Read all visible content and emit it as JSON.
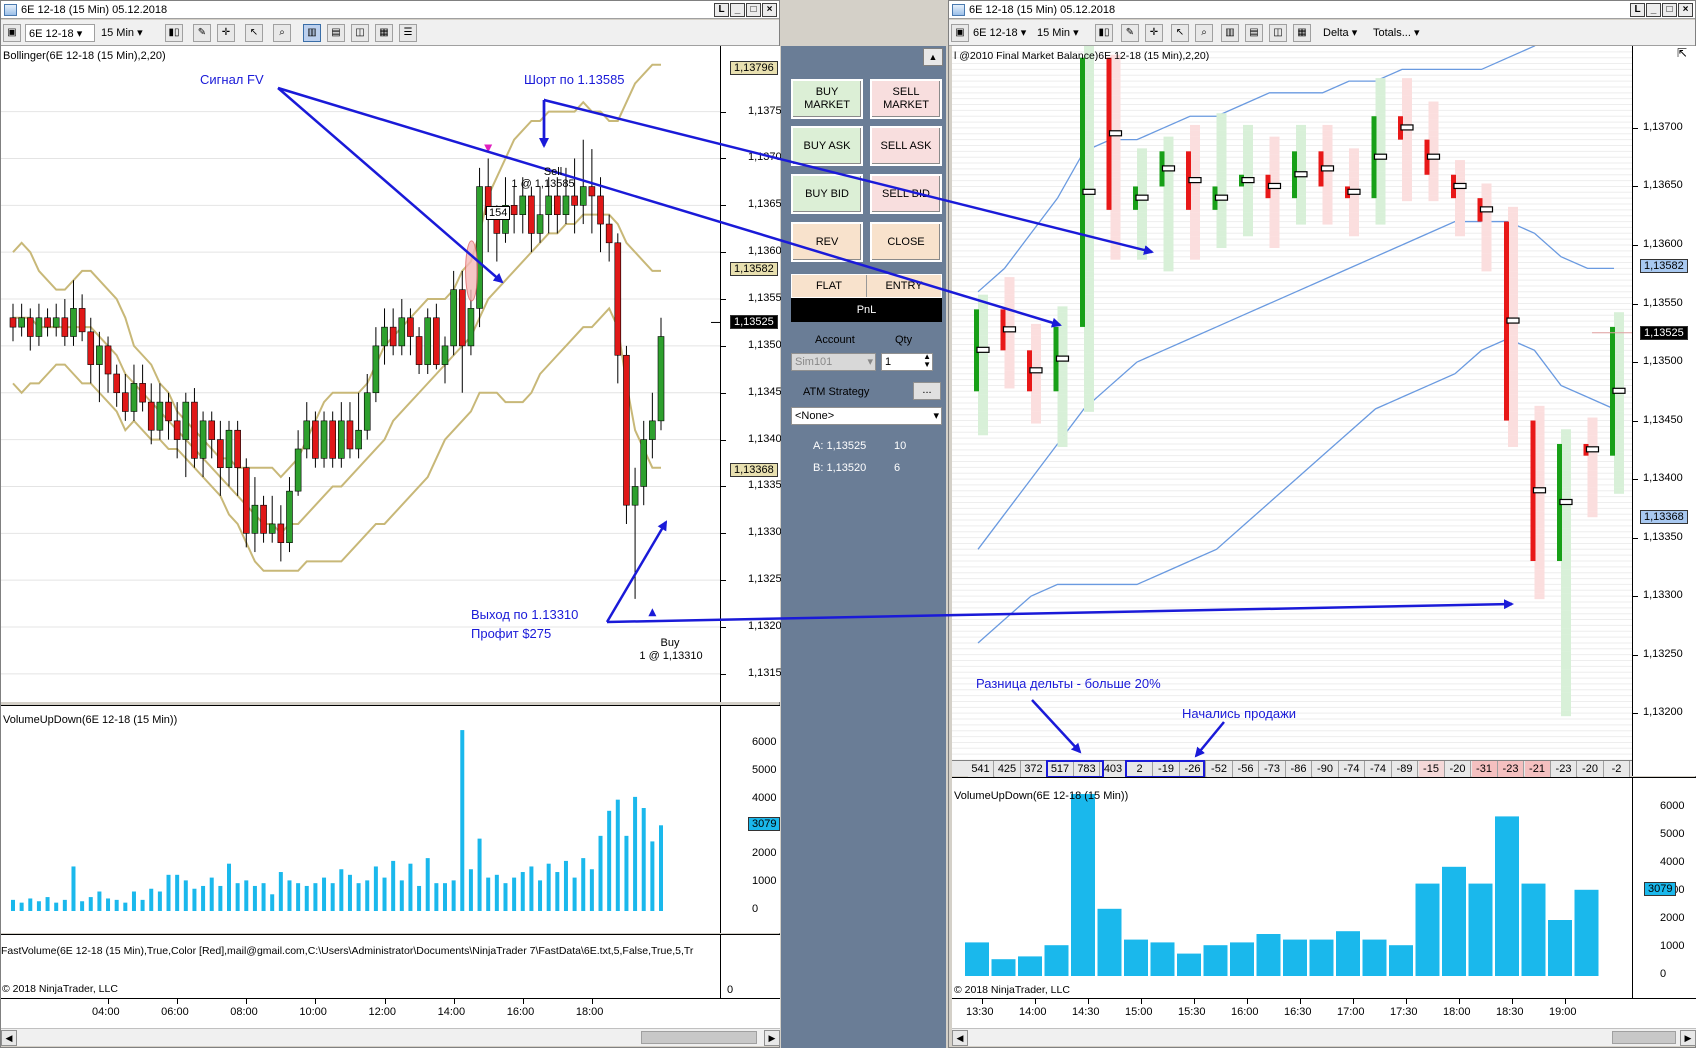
{
  "left_window": {
    "title": "6E 12-18 (15 Min)  05.12.2018",
    "toolbar": {
      "instrument": "6E 12-18",
      "interval": "15 Min"
    },
    "indicator_title": "Bollinger(6E 12-18 (15 Min),2,20)",
    "y_labels": [
      "1,13750",
      "1,13700",
      "1,13650",
      "1,13600",
      "1,13550",
      "1,13500",
      "1,13450",
      "1,13400",
      "1,13350",
      "1,13300",
      "1,13250",
      "1,13200",
      "1,13150"
    ],
    "price_tags": {
      "upper": "1,13796",
      "mid": "1,13582",
      "last": "1,13525",
      "lower": "1,13368"
    },
    "sell_label": "Sell",
    "sell_fill": "1 @ 1,13585",
    "buy_label": "Buy",
    "buy_fill": "1 @ 1,13310",
    "bar_counter": "154",
    "vol_title": "VolumeUpDown(6E 12-18 (15 Min))",
    "vol_labels": [
      "6000",
      "5000",
      "4000",
      "3000",
      "2000",
      "1000",
      "0"
    ],
    "vol_tag": "3079",
    "fastvol_title": "FastVolume(6E  12-18  (15  Min),True,Color  [Red],mail@gmail.com,C:\\Users\\Administrator\\Documents\\NinjaTrader  7\\FastData\\6E.txt,5,False,True,5,Tr",
    "fastvol_zero": "0",
    "copyright": "© 2018 NinjaTrader, LLC",
    "x_labels": [
      "04:00",
      "06:00",
      "08:00",
      "10:00",
      "12:00",
      "14:00",
      "16:00",
      "18:00"
    ]
  },
  "annotations": {
    "signal": "Сигнал FV",
    "short": "Шорт по 1.13585",
    "exit": "Выход по 1.13310",
    "profit": "Профит $275",
    "delta_diff": "Разница дельты - больше 20%",
    "selling": "Начались продажи"
  },
  "trade_panel": {
    "buy_market": "BUY MARKET",
    "sell_market": "SELL MARKET",
    "buy_ask": "BUY ASK",
    "sell_ask": "SELL ASK",
    "buy_bid": "BUY BID",
    "sell_bid": "SELL BID",
    "rev": "REV",
    "close": "CLOSE",
    "flat": "FLAT",
    "entry": "ENTRY",
    "pnl": "PnL",
    "account_label": "Account",
    "qty_label": "Qty",
    "account_value": "Sim101",
    "qty_value": "1",
    "atm_label": "ATM Strategy",
    "atm_more": "...",
    "atm_value": "<None>",
    "ask_label": "A: 1,13525",
    "ask_size": "10",
    "bid_label": "B: 1,13520",
    "bid_size": "6"
  },
  "right_window": {
    "title": "6E 12-18 (15 Min)  05.12.2018",
    "toolbar": {
      "instrument": "6E 12-18",
      "interval": "15 Min",
      "delta": "Delta",
      "totals": "Totals..."
    },
    "indicator_title": "l @2010 Final Market Balance)6E 12-18 (15 Min),2,20)",
    "y_labels": [
      "1,13700",
      "1,13650",
      "1,13600",
      "1,13550",
      "1,13500",
      "1,13450",
      "1,13400",
      "1,13350",
      "1,13300",
      "1,13250",
      "1,13200"
    ],
    "price_tags": {
      "mid": "1,13582",
      "last": "1,13525",
      "lower": "1,13368"
    },
    "deltas": [
      "541",
      "425",
      "372",
      "517",
      "783",
      "403",
      "2",
      "-19",
      "-26",
      "-52",
      "-56",
      "-73",
      "-86",
      "-90",
      "-74",
      "-74",
      "-89",
      "-15",
      "-20",
      "-31",
      "-23",
      "-21",
      "-23",
      "-20",
      "-2"
    ],
    "vol_title": "VolumeUpDown(6E 12-18 (15 Min))",
    "vol_labels": [
      "6000",
      "5000",
      "4000",
      "3000",
      "2000",
      "1000",
      "0"
    ],
    "vol_tag": "3079",
    "copyright": "© 2018 NinjaTrader, LLC",
    "x_labels": [
      "13:30",
      "14:00",
      "14:30",
      "15:00",
      "15:30",
      "16:00",
      "16:30",
      "17:00",
      "17:30",
      "18:00",
      "18:30",
      "19:00"
    ]
  },
  "colors": {
    "up": "#2ea02e",
    "down": "#e01818",
    "band": "#c8b878",
    "vol": "#1ab8ec",
    "arrow": "#1a1ad8",
    "bb_right": "#6a9ae0"
  },
  "chart_data": [
    {
      "type": "candlestick",
      "title": "Bollinger(6E 12-18 (15 Min),2,20)",
      "ylim": [
        1.1312,
        1.1382
      ],
      "candles": [
        [
          1.1353,
          1.1352,
          1.13545,
          1.13505
        ],
        [
          1.1352,
          1.1353,
          1.13545,
          1.1351
        ],
        [
          1.1353,
          1.1351,
          1.1354,
          1.13495
        ],
        [
          1.1351,
          1.1353,
          1.13545,
          1.135
        ],
        [
          1.1353,
          1.1352,
          1.1354,
          1.1351
        ],
        [
          1.1352,
          1.1353,
          1.13545,
          1.1351
        ],
        [
          1.1353,
          1.1351,
          1.1355,
          1.135
        ],
        [
          1.1351,
          1.1354,
          1.1357,
          1.135
        ],
        [
          1.1354,
          1.13515,
          1.13555,
          1.13505
        ],
        [
          1.13515,
          1.1348,
          1.1353,
          1.1346
        ],
        [
          1.1348,
          1.135,
          1.13515,
          1.1344
        ],
        [
          1.135,
          1.1347,
          1.1351,
          1.1345
        ],
        [
          1.1347,
          1.1345,
          1.1348,
          1.13435
        ],
        [
          1.1345,
          1.1343,
          1.1347,
          1.1342
        ],
        [
          1.1343,
          1.1346,
          1.1348,
          1.1342
        ],
        [
          1.1346,
          1.1344,
          1.1348,
          1.1343
        ],
        [
          1.1344,
          1.1341,
          1.1346,
          1.13395
        ],
        [
          1.1341,
          1.1344,
          1.1346,
          1.134
        ],
        [
          1.1344,
          1.1342,
          1.1345,
          1.134
        ],
        [
          1.1342,
          1.134,
          1.1344,
          1.1338
        ],
        [
          1.134,
          1.1344,
          1.1345,
          1.1336
        ],
        [
          1.1344,
          1.1338,
          1.13455,
          1.1337
        ],
        [
          1.1338,
          1.1342,
          1.1343,
          1.1336
        ],
        [
          1.1342,
          1.134,
          1.1343,
          1.1338
        ],
        [
          1.134,
          1.1337,
          1.1342,
          1.1334
        ],
        [
          1.1337,
          1.1341,
          1.1342,
          1.1335
        ],
        [
          1.1341,
          1.1337,
          1.1342,
          1.1334
        ],
        [
          1.1337,
          1.133,
          1.1338,
          1.13285
        ],
        [
          1.133,
          1.1333,
          1.1336,
          1.1328
        ],
        [
          1.1333,
          1.133,
          1.1334,
          1.1329
        ],
        [
          1.133,
          1.1331,
          1.1334,
          1.1329
        ],
        [
          1.1331,
          1.1329,
          1.1333,
          1.1327
        ],
        [
          1.1329,
          1.13345,
          1.1336,
          1.1328
        ],
        [
          1.13345,
          1.1339,
          1.1341,
          1.1334
        ],
        [
          1.1339,
          1.1342,
          1.1344,
          1.1338
        ],
        [
          1.1342,
          1.1338,
          1.1343,
          1.1337
        ],
        [
          1.1338,
          1.1342,
          1.1343,
          1.1337
        ],
        [
          1.1342,
          1.1338,
          1.1343,
          1.1337
        ],
        [
          1.1338,
          1.1342,
          1.1344,
          1.1337
        ],
        [
          1.1342,
          1.1339,
          1.1344,
          1.1338
        ],
        [
          1.1339,
          1.1341,
          1.1345,
          1.1338
        ],
        [
          1.1341,
          1.1345,
          1.1347,
          1.134
        ],
        [
          1.1345,
          1.135,
          1.1352,
          1.1344
        ],
        [
          1.135,
          1.1352,
          1.1354,
          1.1348
        ],
        [
          1.1352,
          1.135,
          1.1354,
          1.1349
        ],
        [
          1.135,
          1.1353,
          1.1355,
          1.1349
        ],
        [
          1.1353,
          1.1351,
          1.1354,
          1.1349
        ],
        [
          1.1351,
          1.1348,
          1.1352,
          1.1347
        ],
        [
          1.1348,
          1.1353,
          1.1354,
          1.1347
        ],
        [
          1.1353,
          1.1348,
          1.13545,
          1.13475
        ],
        [
          1.1348,
          1.135,
          1.1351,
          1.1346
        ],
        [
          1.135,
          1.1356,
          1.1358,
          1.1349
        ],
        [
          1.1356,
          1.135,
          1.1358,
          1.1345
        ],
        [
          1.135,
          1.1354,
          1.1356,
          1.1349
        ],
        [
          1.1354,
          1.1367,
          1.1369,
          1.1352
        ],
        [
          1.1367,
          1.1364,
          1.137,
          1.136
        ],
        [
          1.1364,
          1.1362,
          1.1365,
          1.1359
        ],
        [
          1.1362,
          1.1365,
          1.1368,
          1.1361
        ],
        [
          1.1365,
          1.1364,
          1.1367,
          1.1362
        ],
        [
          1.1364,
          1.1366,
          1.1368,
          1.1362
        ],
        [
          1.1366,
          1.1362,
          1.1367,
          1.136
        ],
        [
          1.1362,
          1.1364,
          1.1367,
          1.1361
        ],
        [
          1.1364,
          1.1366,
          1.1368,
          1.1362
        ],
        [
          1.1366,
          1.1364,
          1.1368,
          1.1362
        ],
        [
          1.1364,
          1.1366,
          1.1369,
          1.1363
        ],
        [
          1.1366,
          1.1365,
          1.137,
          1.1362
        ],
        [
          1.1365,
          1.1367,
          1.1372,
          1.1363
        ],
        [
          1.1367,
          1.1366,
          1.1371,
          1.1362
        ],
        [
          1.1366,
          1.1363,
          1.1368,
          1.136
        ],
        [
          1.1363,
          1.1361,
          1.1364,
          1.1359
        ],
        [
          1.1361,
          1.1349,
          1.1362,
          1.1346
        ],
        [
          1.1349,
          1.1333,
          1.135,
          1.1331
        ],
        [
          1.1333,
          1.1335,
          1.1337,
          1.1323
        ],
        [
          1.1335,
          1.134,
          1.1342,
          1.1333
        ],
        [
          1.134,
          1.1342,
          1.1345,
          1.1338
        ],
        [
          1.1342,
          1.1351,
          1.1353,
          1.1341
        ]
      ],
      "bb_upper": [
        1.136,
        1.1361,
        1.136,
        1.1358,
        1.1357,
        1.1356,
        1.1356,
        1.1357,
        1.1358,
        1.1358,
        1.1357,
        1.1356,
        1.1355,
        1.1353,
        1.135,
        1.1349,
        1.1348,
        1.1346,
        1.1345,
        1.1343,
        1.1342,
        1.1341,
        1.134,
        1.1339,
        1.1338,
        1.1338,
        1.1337,
        1.1337,
        1.1337,
        1.1337,
        1.1337,
        1.1336,
        1.1337,
        1.1338,
        1.134,
        1.1342,
        1.1344,
        1.1345,
        1.1345,
        1.1345,
        1.1345,
        1.1346,
        1.1348,
        1.135,
        1.1351,
        1.1352,
        1.1353,
        1.1354,
        1.1355,
        1.1355,
        1.1355,
        1.1356,
        1.1358,
        1.1359,
        1.1362,
        1.1366,
        1.1368,
        1.137,
        1.1372,
        1.1373,
        1.1374,
        1.1374,
        1.1375,
        1.1375,
        1.1375,
        1.1375,
        1.1376,
        1.1375,
        1.1375,
        1.1374,
        1.1374,
        1.1376,
        1.1378,
        1.1379,
        1.138,
        1.138
      ],
      "bb_mid": [
        1.1353,
        1.1353,
        1.1353,
        1.1352,
        1.1352,
        1.1352,
        1.1352,
        1.1352,
        1.1352,
        1.1352,
        1.1351,
        1.135,
        1.1349,
        1.1347,
        1.1346,
        1.1345,
        1.1344,
        1.1343,
        1.1342,
        1.1341,
        1.134,
        1.1339,
        1.1338,
        1.1337,
        1.1336,
        1.1335,
        1.1334,
        1.1333,
        1.1332,
        1.1331,
        1.1331,
        1.133,
        1.1331,
        1.1331,
        1.1332,
        1.1333,
        1.1334,
        1.1335,
        1.1335,
        1.1336,
        1.1337,
        1.1338,
        1.1339,
        1.134,
        1.1342,
        1.1343,
        1.1344,
        1.1345,
        1.1346,
        1.1347,
        1.1348,
        1.1349,
        1.135,
        1.1351,
        1.1353,
        1.1355,
        1.1356,
        1.1357,
        1.1358,
        1.1359,
        1.136,
        1.1361,
        1.1362,
        1.1362,
        1.1363,
        1.1363,
        1.1364,
        1.1364,
        1.1364,
        1.1364,
        1.1363,
        1.1361,
        1.136,
        1.1359,
        1.1358,
        1.1358
      ],
      "bb_lower": [
        1.1346,
        1.1345,
        1.1346,
        1.1346,
        1.1347,
        1.1348,
        1.1348,
        1.1347,
        1.1346,
        1.1346,
        1.1345,
        1.1344,
        1.1343,
        1.1341,
        1.1342,
        1.1341,
        1.134,
        1.134,
        1.1339,
        1.1339,
        1.1338,
        1.1337,
        1.1336,
        1.1335,
        1.1334,
        1.1332,
        1.1331,
        1.1329,
        1.1327,
        1.1326,
        1.1326,
        1.1326,
        1.1326,
        1.1326,
        1.1327,
        1.1327,
        1.1327,
        1.1327,
        1.1327,
        1.1328,
        1.1329,
        1.133,
        1.1331,
        1.1331,
        1.1332,
        1.1333,
        1.1334,
        1.1335,
        1.1336,
        1.1338,
        1.134,
        1.1341,
        1.1342,
        1.1343,
        1.1345,
        1.1345,
        1.1345,
        1.1344,
        1.1344,
        1.1344,
        1.1345,
        1.1347,
        1.1348,
        1.1349,
        1.135,
        1.1351,
        1.1352,
        1.1352,
        1.1353,
        1.1354,
        1.1352,
        1.1346,
        1.1341,
        1.1339,
        1.1337,
        1.1337
      ],
      "volume": [
        400,
        300,
        450,
        350,
        500,
        300,
        400,
        1600,
        350,
        500,
        700,
        450,
        400,
        300,
        700,
        400,
        800,
        700,
        1300,
        1300,
        1100,
        800,
        900,
        1200,
        900,
        1700,
        1000,
        1100,
        900,
        1000,
        600,
        1400,
        1100,
        1000,
        900,
        1000,
        1200,
        1000,
        1500,
        1300,
        1000,
        1100,
        1600,
        1200,
        1800,
        1100,
        1700,
        900,
        1900,
        1000,
        1000,
        1100,
        6500,
        1500,
        2600,
        1200,
        1300,
        1000,
        1200,
        1400,
        1600,
        1100,
        1700,
        1400,
        1800,
        1200,
        1900,
        1500,
        2700,
        3600,
        4000,
        2700,
        4100,
        3700,
        2500,
        3079
      ]
    },
    {
      "type": "footprint-candlestick",
      "title": "l @2010 Final Market Balance)6E 12-18 (15 Min),2,20)",
      "ylim": [
        1.1316,
        1.1377
      ],
      "candles": [
        [
          1.13475,
          1.13545,
          1.13555,
          1.1344
        ],
        [
          1.13545,
          1.1351,
          1.1357,
          1.1348
        ],
        [
          1.1351,
          1.13475,
          1.1353,
          1.1345
        ],
        [
          1.13475,
          1.1353,
          1.13545,
          1.1343
        ],
        [
          1.1353,
          1.1376,
          1.1379,
          1.1346
        ],
        [
          1.1376,
          1.1363,
          1.1376,
          1.1359
        ],
        [
          1.1363,
          1.1365,
          1.1368,
          1.1359
        ],
        [
          1.1365,
          1.1368,
          1.1369,
          1.1358
        ],
        [
          1.1368,
          1.1363,
          1.137,
          1.1359
        ],
        [
          1.1363,
          1.1365,
          1.1371,
          1.136
        ],
        [
          1.1365,
          1.1366,
          1.137,
          1.1361
        ],
        [
          1.1366,
          1.1364,
          1.1369,
          1.136
        ],
        [
          1.1364,
          1.1368,
          1.137,
          1.1362
        ],
        [
          1.1368,
          1.1365,
          1.137,
          1.1362
        ],
        [
          1.1365,
          1.1364,
          1.1368,
          1.1361
        ],
        [
          1.1364,
          1.1371,
          1.1374,
          1.1362
        ],
        [
          1.1371,
          1.1369,
          1.1374,
          1.1364
        ],
        [
          1.1369,
          1.1366,
          1.1372,
          1.1364
        ],
        [
          1.1366,
          1.1364,
          1.1367,
          1.1361
        ],
        [
          1.1364,
          1.1362,
          1.1365,
          1.1358
        ],
        [
          1.1362,
          1.1345,
          1.1363,
          1.1343
        ],
        [
          1.1345,
          1.1333,
          1.1346,
          1.133
        ],
        [
          1.1333,
          1.1343,
          1.1344,
          1.132
        ],
        [
          1.1343,
          1.1342,
          1.1345,
          1.1337
        ],
        [
          1.1342,
          1.1353,
          1.1354,
          1.1339
        ]
      ],
      "bb_upper": [
        1.1356,
        1.1358,
        1.1361,
        1.1364,
        1.1368,
        1.1369,
        1.1369,
        1.137,
        1.1371,
        1.1371,
        1.1372,
        1.1373,
        1.1373,
        1.1373,
        1.1374,
        1.1374,
        1.1375,
        1.1375,
        1.1375,
        1.1375,
        1.1376,
        1.1377,
        1.1379,
        1.138,
        1.1381
      ],
      "bb_mid": [
        1.1334,
        1.1337,
        1.134,
        1.1343,
        1.1346,
        1.1348,
        1.135,
        1.1351,
        1.1352,
        1.1353,
        1.1354,
        1.1355,
        1.1356,
        1.1357,
        1.1358,
        1.1359,
        1.136,
        1.1361,
        1.1362,
        1.1362,
        1.1362,
        1.1361,
        1.1359,
        1.1358,
        1.1358
      ],
      "bb_lower": [
        1.1326,
        1.1328,
        1.133,
        1.1331,
        1.1331,
        1.1331,
        1.1331,
        1.1332,
        1.1333,
        1.1334,
        1.1336,
        1.1338,
        1.134,
        1.1342,
        1.1344,
        1.1346,
        1.1347,
        1.1348,
        1.1349,
        1.1351,
        1.1352,
        1.1351,
        1.1348,
        1.1347,
        1.1346
      ],
      "volume": [
        1200,
        600,
        700,
        1100,
        6500,
        2400,
        1300,
        1200,
        800,
        1100,
        1200,
        1500,
        1300,
        1300,
        1600,
        1300,
        1100,
        3300,
        3900,
        3300,
        5700,
        3300,
        2000,
        3079,
        0
      ]
    }
  ]
}
